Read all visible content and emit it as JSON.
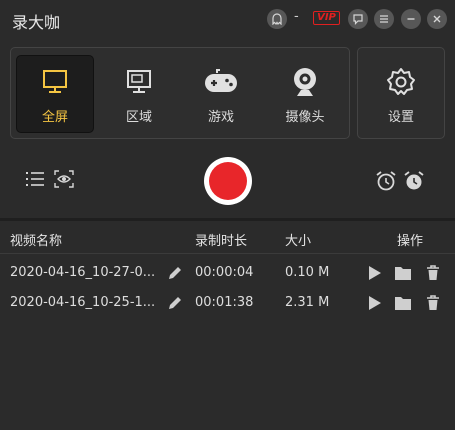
{
  "app": {
    "title": "录大咖",
    "dash": "-",
    "vip_label": "VIP"
  },
  "window_controls": [
    "ghost-icon",
    "chat-icon",
    "menu-icon",
    "minimize-icon",
    "close-icon"
  ],
  "modes": [
    {
      "label": "全屏",
      "icon": "monitor-icon",
      "active": true
    },
    {
      "label": "区域",
      "icon": "region-monitor-icon",
      "active": false
    },
    {
      "label": "游戏",
      "icon": "gamepad-icon",
      "active": false
    },
    {
      "label": "摄像头",
      "icon": "webcam-icon",
      "active": false
    }
  ],
  "settings": {
    "label": "设置",
    "icon": "gear-icon"
  },
  "colors": {
    "accent": "#f5c542",
    "record": "#e8262a",
    "vip": "#e02020",
    "background": "#2b2b2b"
  },
  "table": {
    "headers": {
      "name": "视频名称",
      "duration": "录制时长",
      "size": "大小",
      "actions": "操作"
    },
    "rows": [
      {
        "name": "2020-04-16_10-27-0...",
        "duration": "00:00:04",
        "size": "0.10 M"
      },
      {
        "name": "2020-04-16_10-25-1...",
        "duration": "00:01:38",
        "size": "2.31 M"
      }
    ]
  }
}
